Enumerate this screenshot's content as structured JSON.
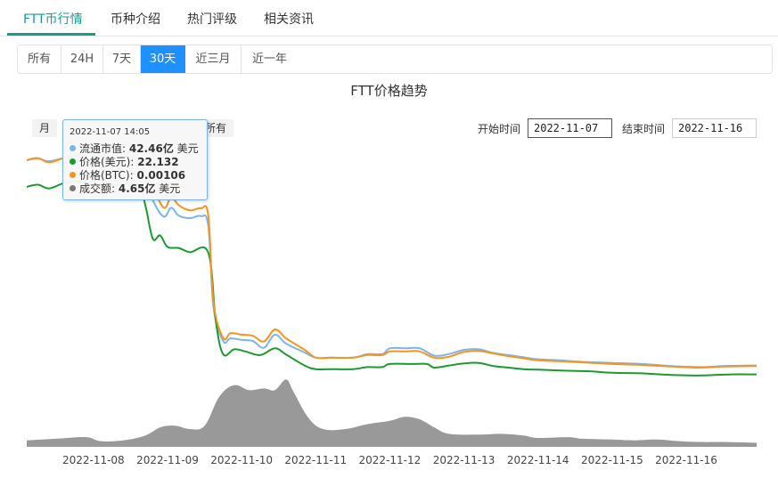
{
  "tabs": [
    {
      "label": "FTT币行情",
      "active": true
    },
    {
      "label": "币种介绍",
      "active": false
    },
    {
      "label": "热门评级",
      "active": false
    },
    {
      "label": "相关资讯",
      "active": false
    }
  ],
  "ranges": [
    {
      "label": "所有",
      "active": false
    },
    {
      "label": "24H",
      "active": false
    },
    {
      "label": "7天",
      "active": false
    },
    {
      "label": "30天",
      "active": true
    },
    {
      "label": "近三月",
      "active": false
    },
    {
      "label": "近一年",
      "active": false
    }
  ],
  "range_selector": {
    "zoom_month": "月",
    "zoom_all": "所有",
    "start_label": "开始时间",
    "start_value": "2022-11-07",
    "end_label": "结束时间",
    "end_value": "2022-11-16"
  },
  "tooltip": {
    "time": "2022-11-07 14:05",
    "rows": [
      {
        "label": "流通市值: ",
        "value": "42.46亿",
        "unit": " 美元",
        "color": "#7cb5ec"
      },
      {
        "label": "价格(美元): ",
        "value": "22.132",
        "unit": "",
        "color": "#1a9a30"
      },
      {
        "label": "价格(BTC): ",
        "value": "0.00106",
        "unit": "",
        "color": "#f7931e"
      },
      {
        "label": "成交额: ",
        "value": "4.65亿",
        "unit": " 美元",
        "color": "#777777"
      }
    ]
  },
  "colors": {
    "market_cap": "#7cb5ec",
    "price_usd": "#1a9a30",
    "price_btc": "#f7931e",
    "volume": "#999999",
    "accent": "#1e90ff",
    "tab_active": "#1a9c8c"
  },
  "chart_data": {
    "type": "line",
    "title": "FTT价格趋势",
    "x_ticks": [
      "2022-11-08",
      "2022-11-09",
      "2022-11-10",
      "2022-11-11",
      "2022-11-12",
      "2022-11-13",
      "2022-11-14",
      "2022-11-15",
      "2022-11-16"
    ],
    "x_range": [
      7.1,
      16.95
    ],
    "series": [
      {
        "name": "流通市值",
        "unit": "亿美元",
        "axis": "price",
        "points": [
          [
            7.1,
            42.6
          ],
          [
            7.25,
            42.9
          ],
          [
            7.4,
            42.4
          ],
          [
            7.6,
            43.0
          ],
          [
            7.8,
            43.4
          ],
          [
            8.0,
            42.6
          ],
          [
            8.3,
            42.9
          ],
          [
            8.6,
            42.5
          ],
          [
            8.8,
            35.0
          ],
          [
            8.95,
            31.8
          ],
          [
            9.05,
            33.5
          ],
          [
            9.15,
            32.0
          ],
          [
            9.3,
            31.5
          ],
          [
            9.45,
            31.9
          ],
          [
            9.55,
            30.0
          ],
          [
            9.62,
            14.5
          ],
          [
            9.75,
            8.0
          ],
          [
            9.85,
            8.5
          ],
          [
            10.0,
            8.2
          ],
          [
            10.15,
            8.0
          ],
          [
            10.3,
            6.7
          ],
          [
            10.45,
            9.2
          ],
          [
            10.6,
            7.5
          ],
          [
            10.85,
            5.8
          ],
          [
            11.0,
            4.8
          ],
          [
            11.2,
            4.8
          ],
          [
            11.5,
            4.8
          ],
          [
            11.7,
            5.5
          ],
          [
            11.9,
            5.5
          ],
          [
            12.0,
            6.6
          ],
          [
            12.2,
            6.6
          ],
          [
            12.4,
            6.6
          ],
          [
            12.6,
            5.2
          ],
          [
            12.8,
            5.5
          ],
          [
            13.0,
            6.3
          ],
          [
            13.2,
            6.4
          ],
          [
            13.4,
            5.7
          ],
          [
            13.6,
            5.3
          ],
          [
            13.8,
            4.9
          ],
          [
            14.0,
            4.5
          ],
          [
            14.3,
            4.3
          ],
          [
            14.6,
            4.0
          ],
          [
            15.0,
            3.8
          ],
          [
            15.4,
            3.6
          ],
          [
            15.8,
            3.2
          ],
          [
            16.2,
            3.0
          ],
          [
            16.5,
            3.2
          ],
          [
            16.95,
            3.3
          ]
        ]
      },
      {
        "name": "价格(美元)",
        "unit": "美元",
        "axis": "price",
        "points": [
          [
            7.1,
            37.5
          ],
          [
            7.25,
            37.9
          ],
          [
            7.4,
            37.2
          ],
          [
            7.6,
            38.2
          ],
          [
            7.8,
            38.5
          ],
          [
            8.0,
            38.0
          ],
          [
            8.2,
            37.8
          ],
          [
            8.6,
            37.8
          ],
          [
            8.7,
            34.0
          ],
          [
            8.8,
            27.6
          ],
          [
            8.9,
            28.2
          ],
          [
            9.0,
            26.0
          ],
          [
            9.15,
            25.8
          ],
          [
            9.3,
            25.0
          ],
          [
            9.55,
            24.9
          ],
          [
            9.65,
            12.0
          ],
          [
            9.75,
            5.5
          ],
          [
            9.9,
            6.4
          ],
          [
            10.05,
            6.0
          ],
          [
            10.25,
            5.3
          ],
          [
            10.45,
            6.6
          ],
          [
            10.6,
            5.4
          ],
          [
            10.85,
            3.3
          ],
          [
            11.0,
            2.6
          ],
          [
            11.2,
            2.6
          ],
          [
            11.5,
            2.6
          ],
          [
            11.7,
            3.0
          ],
          [
            11.9,
            3.0
          ],
          [
            12.0,
            3.6
          ],
          [
            12.3,
            3.6
          ],
          [
            12.5,
            3.6
          ],
          [
            12.6,
            2.9
          ],
          [
            12.8,
            3.3
          ],
          [
            13.0,
            3.7
          ],
          [
            13.2,
            3.8
          ],
          [
            13.4,
            3.2
          ],
          [
            13.6,
            2.9
          ],
          [
            13.8,
            2.6
          ],
          [
            14.0,
            2.5
          ],
          [
            14.4,
            2.3
          ],
          [
            14.7,
            2.2
          ],
          [
            15.0,
            1.9
          ],
          [
            15.4,
            1.8
          ],
          [
            15.8,
            1.5
          ],
          [
            16.2,
            1.4
          ],
          [
            16.6,
            1.6
          ],
          [
            16.95,
            1.6
          ]
        ]
      },
      {
        "name": "价格(BTC)",
        "unit": "BTC",
        "axis": "price",
        "points": [
          [
            7.1,
            42.6
          ],
          [
            7.25,
            43.0
          ],
          [
            7.4,
            42.2
          ],
          [
            7.6,
            43.0
          ],
          [
            7.8,
            43.6
          ],
          [
            8.0,
            42.6
          ],
          [
            8.3,
            42.9
          ],
          [
            8.6,
            42.8
          ],
          [
            8.8,
            37.5
          ],
          [
            8.95,
            33.5
          ],
          [
            9.05,
            35.5
          ],
          [
            9.15,
            34.0
          ],
          [
            9.3,
            33.0
          ],
          [
            9.45,
            33.4
          ],
          [
            9.55,
            32.0
          ],
          [
            9.62,
            15.5
          ],
          [
            9.75,
            8.6
          ],
          [
            9.85,
            9.5
          ],
          [
            10.0,
            9.2
          ],
          [
            10.15,
            9.0
          ],
          [
            10.3,
            7.9
          ],
          [
            10.45,
            10.2
          ],
          [
            10.6,
            8.5
          ],
          [
            10.85,
            6.3
          ],
          [
            11.0,
            4.8
          ],
          [
            11.2,
            4.8
          ],
          [
            11.5,
            4.8
          ],
          [
            11.7,
            5.3
          ],
          [
            11.9,
            5.3
          ],
          [
            12.0,
            6.0
          ],
          [
            12.2,
            6.0
          ],
          [
            12.4,
            6.0
          ],
          [
            12.6,
            4.8
          ],
          [
            12.8,
            5.0
          ],
          [
            13.0,
            5.9
          ],
          [
            13.2,
            6.1
          ],
          [
            13.4,
            5.6
          ],
          [
            13.6,
            5.1
          ],
          [
            13.8,
            4.7
          ],
          [
            14.0,
            4.3
          ],
          [
            14.3,
            4.1
          ],
          [
            14.6,
            3.9
          ],
          [
            15.0,
            3.6
          ],
          [
            15.4,
            3.4
          ],
          [
            15.8,
            3.1
          ],
          [
            16.2,
            2.9
          ],
          [
            16.5,
            3.1
          ],
          [
            16.95,
            3.2
          ]
        ]
      },
      {
        "name": "成交额",
        "unit": "亿美元",
        "axis": "volume",
        "points": [
          [
            7.1,
            0.8
          ],
          [
            7.5,
            1.0
          ],
          [
            7.9,
            1.2
          ],
          [
            8.1,
            0.7
          ],
          [
            8.4,
            0.8
          ],
          [
            8.7,
            1.4
          ],
          [
            8.9,
            2.4
          ],
          [
            9.1,
            2.6
          ],
          [
            9.3,
            2.2
          ],
          [
            9.5,
            2.6
          ],
          [
            9.7,
            6.2
          ],
          [
            9.9,
            7.6
          ],
          [
            10.1,
            7.0
          ],
          [
            10.3,
            7.2
          ],
          [
            10.45,
            7.0
          ],
          [
            10.6,
            8.3
          ],
          [
            10.7,
            6.8
          ],
          [
            10.9,
            3.6
          ],
          [
            11.1,
            2.2
          ],
          [
            11.4,
            2.2
          ],
          [
            11.7,
            2.8
          ],
          [
            12.0,
            3.2
          ],
          [
            12.2,
            3.7
          ],
          [
            12.4,
            3.4
          ],
          [
            12.6,
            2.4
          ],
          [
            12.8,
            1.6
          ],
          [
            13.2,
            1.5
          ],
          [
            13.5,
            1.6
          ],
          [
            13.8,
            1.4
          ],
          [
            14.0,
            1.1
          ],
          [
            14.4,
            1.2
          ],
          [
            14.6,
            1.0
          ],
          [
            15.0,
            0.9
          ],
          [
            15.3,
            0.8
          ],
          [
            15.6,
            0.9
          ],
          [
            15.9,
            0.7
          ],
          [
            16.2,
            0.6
          ],
          [
            16.5,
            0.6
          ],
          [
            16.95,
            0.5
          ]
        ]
      }
    ]
  }
}
